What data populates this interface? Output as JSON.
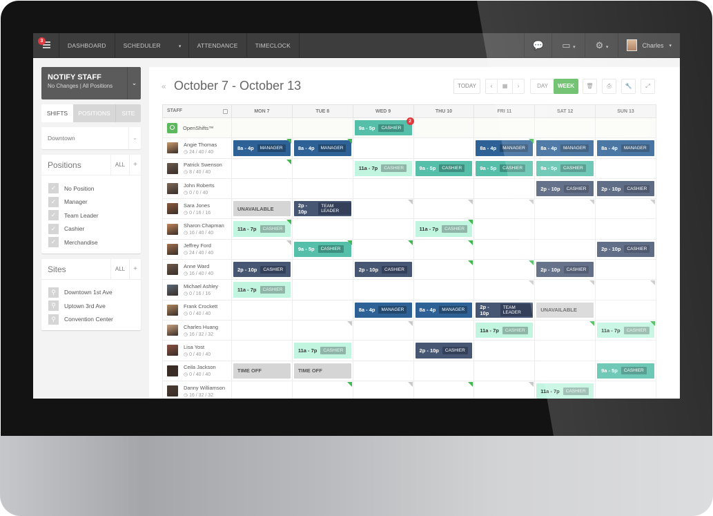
{
  "nav": {
    "menu_badge": "3",
    "items": [
      "DASHBOARD",
      "SCHEDULER",
      "ATTENDANCE",
      "TIMECLOCK"
    ],
    "scheduler_caret": "▾",
    "icons": {
      "chat": "💬",
      "inbox": "▭",
      "settings": "⚙"
    },
    "user_name": "Charles",
    "caret": "▾"
  },
  "sidebar": {
    "notify_title": "NOTIFY STAFF",
    "notify_sub": "No Changes  |  All Positions",
    "tabs": [
      "SHIFTS",
      "POSITIONS",
      "SITE"
    ],
    "location": "Downtown",
    "positions_title": "Positions",
    "positions": [
      "No Position",
      "Manager",
      "Team Leader",
      "Cashier",
      "Merchandise"
    ],
    "sites_title": "Sites",
    "sites": [
      "Downtown 1st Ave",
      "Uptown 3rd Ave",
      "Convention Center"
    ],
    "all_label": "ALL",
    "plus_label": "+"
  },
  "toolbar": {
    "prev": "«",
    "range": "October 7 - October 13",
    "today": "TODAY",
    "day": "DAY",
    "week": "WEEK",
    "left": "‹",
    "right": "›",
    "cal": "▦",
    "trash": "🗑",
    "print": "⎙",
    "wrench": "🔧",
    "expand": "⤢"
  },
  "grid": {
    "staff_header": "STAFF",
    "days": [
      "MON 7",
      "TUE 8",
      "WED 9",
      "THU 10",
      "FRI 11",
      "SAT 12",
      "SUN 13"
    ],
    "open": {
      "label": "OpenShifts™",
      "shifts": [
        null,
        null,
        {
          "t": "9a - 5p",
          "p": "CASHIER",
          "c": "teal",
          "badge": "2"
        },
        null,
        null,
        null,
        null
      ]
    },
    "rows": [
      {
        "name": "Angie Thomas",
        "hours": "24 / 40 / 40",
        "shifts": [
          {
            "t": "8a - 4p",
            "p": "MANAGER",
            "c": "manager",
            "f": "g"
          },
          {
            "t": "8a - 4p",
            "p": "MANAGER",
            "c": "manager",
            "f": "g"
          },
          null,
          null,
          {
            "t": "8a - 4p",
            "p": "MANAGER",
            "c": "manager",
            "f": "g"
          },
          {
            "t": "8a - 4p",
            "p": "MANAGER",
            "c": "manager"
          },
          {
            "t": "8a - 4p",
            "p": "MANAGER",
            "c": "manager"
          }
        ]
      },
      {
        "name": "Patrick Swenson",
        "hours": "8 / 40 / 40",
        "shifts": [
          {
            "f": "g"
          },
          null,
          {
            "t": "11a - 7p",
            "p": "CASHIER",
            "c": "mint"
          },
          {
            "t": "9a - 5p",
            "p": "CASHIER",
            "c": "teal"
          },
          {
            "t": "9a - 5p",
            "p": "CASHIER",
            "c": "teal"
          },
          {
            "t": "9a - 5p",
            "p": "CASHIER",
            "c": "teal"
          },
          null
        ]
      },
      {
        "name": "John Roberts",
        "hours": "0 / 0 / 40",
        "shifts": [
          null,
          null,
          null,
          null,
          null,
          {
            "t": "2p - 10p",
            "p": "CASHIER",
            "c": "dark"
          },
          {
            "t": "2p - 10p",
            "p": "CASHIER",
            "c": "dark"
          }
        ]
      },
      {
        "name": "Sara Jones",
        "hours": "0 / 16 / 16",
        "shifts": [
          {
            "t": "UNAVAILABLE",
            "c": "gray"
          },
          {
            "t": "2p - 10p",
            "p": "TEAM LEADER",
            "c": "dark"
          },
          {
            "f": "gr"
          },
          {
            "f": "gr"
          },
          {
            "f": "gr"
          },
          {
            "f": "gr"
          },
          {
            "f": "gr"
          }
        ]
      },
      {
        "name": "Sharon Chapman",
        "hours": "16 / 40 / 40",
        "shifts": [
          {
            "t": "11a - 7p",
            "p": "CASHIER",
            "c": "mint",
            "f": "g"
          },
          null,
          null,
          {
            "t": "11a - 7p",
            "p": "CASHIER",
            "c": "mint",
            "f": "g"
          },
          null,
          null,
          null
        ]
      },
      {
        "name": "Jeffrey Ford",
        "hours": "24 / 40 / 40",
        "shifts": [
          {
            "f": "gr"
          },
          {
            "t": "9a - 5p",
            "p": "CASHIER",
            "c": "teal",
            "f": "g"
          },
          {
            "f": "g"
          },
          {
            "f": "g"
          },
          null,
          null,
          {
            "t": "2p - 10p",
            "p": "CASHIER",
            "c": "dark"
          }
        ]
      },
      {
        "name": "Anne Ward",
        "hours": "16 / 40 / 40",
        "shifts": [
          {
            "t": "2p - 10p",
            "p": "CASHIER",
            "c": "dark"
          },
          null,
          {
            "t": "2p - 10p",
            "p": "CASHIER",
            "c": "dark"
          },
          {
            "f": "g"
          },
          {
            "f": "g"
          },
          {
            "t": "2p - 10p",
            "p": "CASHIER",
            "c": "dark"
          },
          null
        ]
      },
      {
        "name": "Michael Ashley",
        "hours": "0 / 16 / 16",
        "shifts": [
          {
            "t": "11a - 7p",
            "p": "CASHIER",
            "c": "mint"
          },
          null,
          null,
          null,
          {
            "f": "gr"
          },
          {
            "f": "gr"
          },
          {
            "f": "gr"
          }
        ]
      },
      {
        "name": "Frank Crockett",
        "hours": "0 / 40 / 40",
        "shifts": [
          null,
          null,
          {
            "t": "8a - 4p",
            "p": "MANAGER",
            "c": "manager"
          },
          {
            "t": "8a - 4p",
            "p": "MANAGER",
            "c": "manager"
          },
          {
            "t": "2p - 10p",
            "p": "TEAM LEADER",
            "c": "dark"
          },
          {
            "t": "UNAVAILABLE",
            "c": "gray"
          },
          null
        ]
      },
      {
        "name": "Charles Huang",
        "hours": "16 / 32 / 32",
        "shifts": [
          null,
          {
            "f": "gr"
          },
          {
            "f": "gr"
          },
          null,
          {
            "t": "11a - 7p",
            "p": "CASHIER",
            "c": "mint"
          },
          {
            "f": "g"
          },
          {
            "t": "11a - 7p",
            "p": "CASHIER",
            "c": "mint",
            "f": "g"
          }
        ]
      },
      {
        "name": "Lisa Yost",
        "hours": "0 / 40 / 40",
        "shifts": [
          null,
          {
            "t": "11a - 7p",
            "p": "CASHIER",
            "c": "mint"
          },
          null,
          {
            "t": "2p - 10p",
            "p": "CASHIER",
            "c": "dark"
          },
          null,
          null,
          null
        ]
      },
      {
        "name": "Ceila Jackson",
        "hours": "0 / 40 / 40",
        "shifts": [
          {
            "t": "TIME OFF",
            "c": "gray"
          },
          {
            "t": "TIME OFF",
            "c": "gray"
          },
          null,
          null,
          null,
          null,
          {
            "t": "9a - 5p",
            "p": "CASHIER",
            "c": "teal"
          }
        ]
      },
      {
        "name": "Danny  Williamson",
        "hours": "16 / 32 / 32",
        "shifts": [
          null,
          {
            "f": "g"
          },
          {
            "f": "gr"
          },
          {
            "f": "g"
          },
          {
            "f": "gr"
          },
          {
            "t": "11a - 7p",
            "p": "CASHIER",
            "c": "mint"
          },
          null
        ]
      }
    ]
  }
}
